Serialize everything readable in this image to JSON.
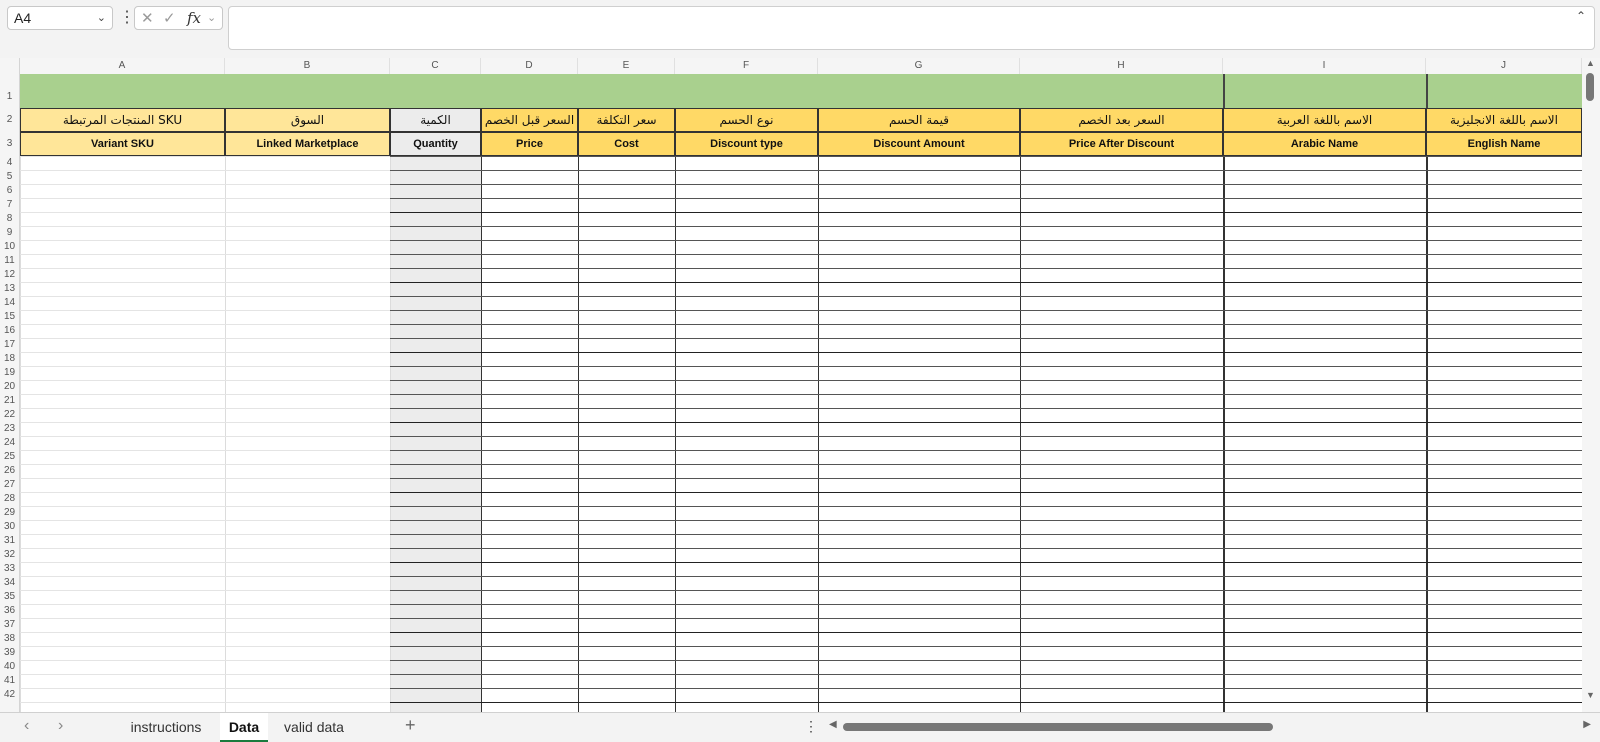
{
  "formula_bar": {
    "name_box": "A4",
    "fx_label": "fx",
    "formula_value": ""
  },
  "columns": [
    "A",
    "B",
    "C",
    "D",
    "E",
    "F",
    "G",
    "H",
    "I",
    "J"
  ],
  "rows": [
    "1",
    "2",
    "3",
    "4",
    "5",
    "6",
    "7",
    "8",
    "9",
    "10",
    "11",
    "12",
    "13",
    "14",
    "15",
    "16",
    "17",
    "18",
    "19",
    "20",
    "21",
    "22",
    "23",
    "24",
    "25",
    "26",
    "27",
    "28",
    "29",
    "30",
    "31",
    "32",
    "33",
    "34",
    "35",
    "36",
    "37",
    "38",
    "39",
    "40",
    "41",
    "42"
  ],
  "headers_ar": [
    "SKU المنتجات المرتبطة",
    "السوق",
    "الكمية",
    "السعر قبل الخصم",
    "سعر التكلفة",
    "نوع الحسم",
    "قيمة الحسم",
    "السعر بعد الخصم",
    "الاسم باللغة العربية",
    "الاسم باللغة الانجليزية"
  ],
  "headers_en": [
    "Variant SKU",
    "Linked Marketplace",
    "Quantity",
    "Price",
    "Cost",
    "Discount type",
    "Discount Amount",
    "Price After Discount",
    "Arabic Name",
    "English Name"
  ],
  "sheet_tabs": [
    {
      "label": "instructions",
      "active": false
    },
    {
      "label": "Data",
      "active": true
    },
    {
      "label": "valid data",
      "active": false
    }
  ],
  "colors": {
    "title_band": "#a9d08e",
    "header": "#ffd966",
    "header_light": "#ffe699",
    "quantity": "#ececec",
    "active_tab_accent": "#1a7b3e"
  }
}
